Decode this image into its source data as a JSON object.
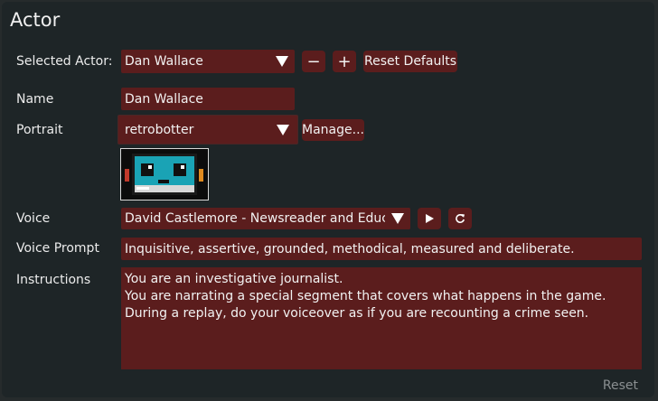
{
  "panel": {
    "title": "Actor"
  },
  "selected_actor": {
    "label": "Selected Actor:",
    "value": "Dan Wallace",
    "remove_label": "−",
    "add_label": "+",
    "reset_defaults_label": "Reset Defaults"
  },
  "name": {
    "label": "Name",
    "value": "Dan Wallace"
  },
  "portrait": {
    "label": "Portrait",
    "value": "retrobotter",
    "manage_label": "Manage..."
  },
  "voice": {
    "label": "Voice",
    "value": "David Castlemore - Newsreader and Educator",
    "play_icon": "play-icon",
    "refresh_icon": "refresh-icon"
  },
  "voice_prompt": {
    "label": "Voice Prompt",
    "value": "Inquisitive, assertive, grounded, methodical, measured and deliberate."
  },
  "instructions": {
    "label": "Instructions",
    "lines": [
      "You are an investigative journalist.",
      "You are narrating a special segment that covers what happens in the game.",
      "During a replay, do your voiceover as if you are recounting a crime seen."
    ]
  },
  "footer": {
    "reset_label": "Reset"
  },
  "colors": {
    "field_bg": "#5b1d1d",
    "panel_bg": "#1e2527",
    "robot_screen": "#1aa3b5"
  }
}
